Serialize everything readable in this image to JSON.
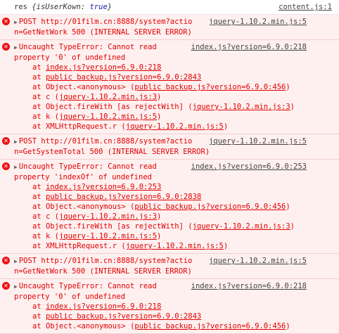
{
  "log": {
    "name": "res",
    "object_open": "{isUserKown: ",
    "value": "true",
    "object_close": "}",
    "source": "content.js:1"
  },
  "entries": [
    {
      "type": "post",
      "line1": "POST http://01film.cn:8888/system?actio",
      "source": "jquery-1.10.2.min.js:5",
      "line2": "n=GetNetWork 500 (INTERNAL SERVER ERROR)"
    },
    {
      "type": "error",
      "line1": "Uncaught TypeError: Cannot read",
      "source": "index.js?version=6.9.0:218",
      "line2": "property '0' of undefined",
      "stack": [
        {
          "pre": "at ",
          "link": "index.js?version=6.9.0:218",
          "post": ""
        },
        {
          "pre": "at ",
          "link": "public backup.js?version=6.9.0:2843",
          "post": ""
        },
        {
          "pre": "at Object.<anonymous> (",
          "link": "public backup.js?version=6.9.0:456",
          "post": ")"
        },
        {
          "pre": "at c (",
          "link": "jquery-1.10.2.min.js:3",
          "post": ")"
        },
        {
          "pre": "at Object.fireWith [as rejectWith] (",
          "link": "jquery-1.10.2.min.js:3",
          "post": ")"
        },
        {
          "pre": "at k (",
          "link": "jquery-1.10.2.min.js:5",
          "post": ")"
        },
        {
          "pre": "at XMLHttpRequest.r (",
          "link": "jquery-1.10.2.min.js:5",
          "post": ")"
        }
      ]
    },
    {
      "type": "post",
      "line1": "POST http://01film.cn:8888/system?actio",
      "source": "jquery-1.10.2.min.js:5",
      "line2": "n=GetSystemTotal 500 (INTERNAL SERVER ERROR)"
    },
    {
      "type": "error",
      "line1": "Uncaught TypeError: Cannot read",
      "source": "index.js?version=6.9.0:253",
      "line2": "property 'indexOf' of undefined",
      "stack": [
        {
          "pre": "at ",
          "link": "index.js?version=6.9.0:253",
          "post": ""
        },
        {
          "pre": "at ",
          "link": "public backup.js?version=6.9.0:2838",
          "post": ""
        },
        {
          "pre": "at Object.<anonymous> (",
          "link": "public backup.js?version=6.9.0:456",
          "post": ")"
        },
        {
          "pre": "at c (",
          "link": "jquery-1.10.2.min.js:3",
          "post": ")"
        },
        {
          "pre": "at Object.fireWith [as rejectWith] (",
          "link": "jquery-1.10.2.min.js:3",
          "post": ")"
        },
        {
          "pre": "at k (",
          "link": "jquery-1.10.2.min.js:5",
          "post": ")"
        },
        {
          "pre": "at XMLHttpRequest.r (",
          "link": "jquery-1.10.2.min.js:5",
          "post": ")"
        }
      ]
    },
    {
      "type": "post",
      "line1": "POST http://01film.cn:8888/system?actio",
      "source": "jquery-1.10.2.min.js:5",
      "line2": "n=GetNetWork 500 (INTERNAL SERVER ERROR)"
    },
    {
      "type": "error",
      "line1": "Uncaught TypeError: Cannot read",
      "source": "index.js?version=6.9.0:218",
      "line2": "property '0' of undefined",
      "stack": [
        {
          "pre": "at ",
          "link": "index.js?version=6.9.0:218",
          "post": ""
        },
        {
          "pre": "at ",
          "link": "public backup.js?version=6.9.0:2843",
          "post": ""
        },
        {
          "pre": "at Object.<anonymous> (",
          "link": "public backup.js?version=6.9.0:456",
          "post": ")"
        }
      ]
    }
  ],
  "colors": {
    "error_text": "#e00000",
    "error_bg": "#fff0f0",
    "error_icon": "#e11111"
  },
  "icons": {
    "error": "error-x-icon",
    "expand": "triangle-right-icon"
  }
}
